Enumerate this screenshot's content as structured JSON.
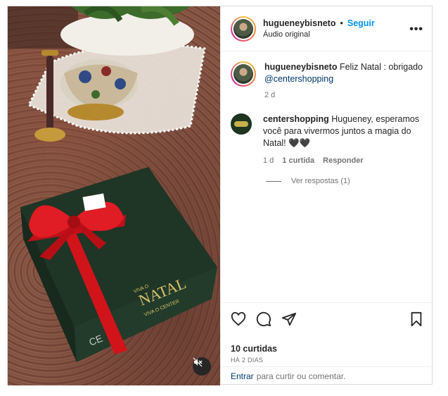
{
  "post": {
    "username": "hugueneybisneto",
    "separator": "•",
    "follow_label": "Seguir",
    "audio": "Áudio original",
    "more_label": "•••"
  },
  "caption": {
    "username": "hugueneybisneto",
    "text": "Feliz Natal : obrigado",
    "mention": "@centershopping",
    "age": "2 d"
  },
  "comment": {
    "username": "centershopping",
    "text": "Hugueney, esperamos você para vivermos juntos a magia do Natal! 🖤🖤",
    "age": "1 d",
    "likes": "1 curtida",
    "reply_label": "Responder",
    "view_replies": "Ver respostas (1)"
  },
  "stats": {
    "likes": "10 curtidas",
    "time": "HÁ 2 DIAS"
  },
  "login": {
    "enter": "Entrar",
    "rest": "para curtir ou comentar."
  },
  "photo": {
    "box_text_top": "VIVA O",
    "box_text_main": "NATAL",
    "box_text_bottom": "VIVA O CENTER",
    "box_side_text": "CE"
  },
  "colors": {
    "follow": "#0095f6",
    "ribbon": "#d0141a",
    "box": "#1f3526"
  }
}
